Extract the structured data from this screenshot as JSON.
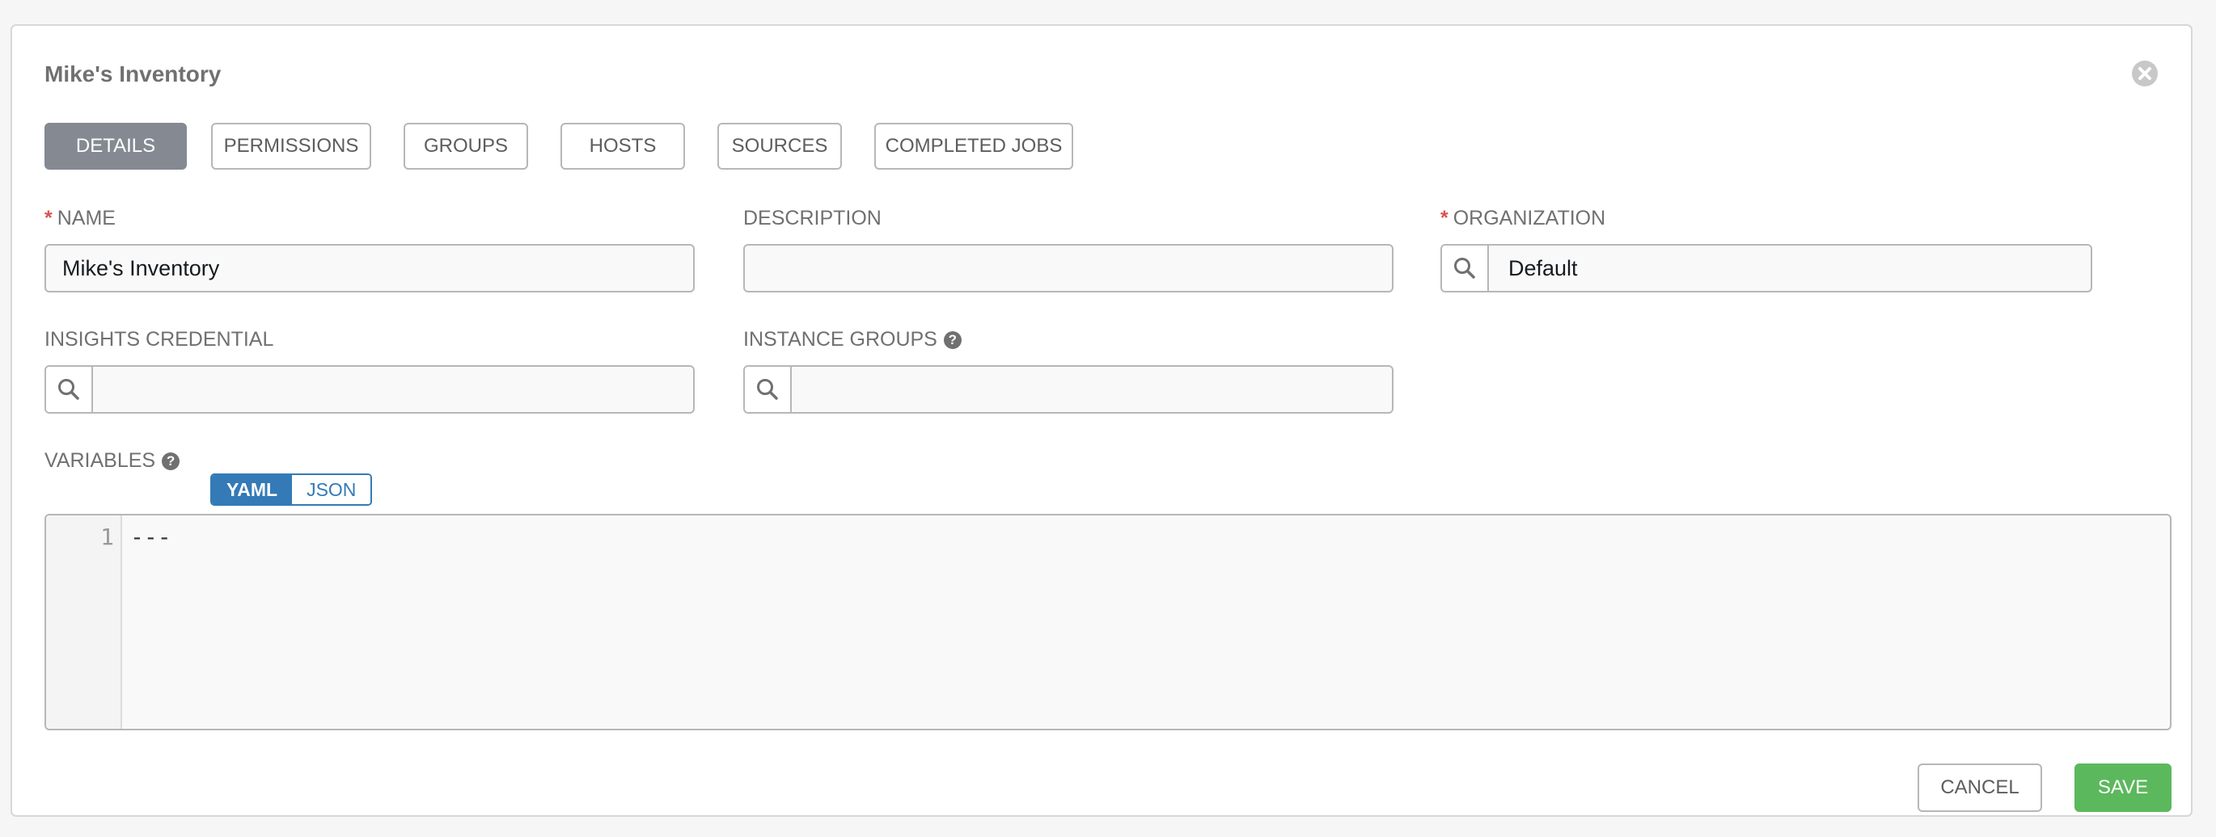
{
  "dialog": {
    "title": "Mike's Inventory",
    "close_icon": "close-circle-icon"
  },
  "tabs": [
    {
      "label": "DETAILS",
      "active": true
    },
    {
      "label": "PERMISSIONS",
      "active": false
    },
    {
      "label": "GROUPS",
      "active": false
    },
    {
      "label": "HOSTS",
      "active": false
    },
    {
      "label": "SOURCES",
      "active": false
    },
    {
      "label": "COMPLETED JOBS",
      "active": false
    }
  ],
  "form": {
    "name": {
      "label": "NAME",
      "required_marker": "*",
      "value": "Mike's Inventory"
    },
    "description": {
      "label": "DESCRIPTION",
      "value": ""
    },
    "organization": {
      "label": "ORGANIZATION",
      "required_marker": "*",
      "value": "Default",
      "icon": "search-icon"
    },
    "insights_credential": {
      "label": "INSIGHTS CREDENTIAL",
      "value": "",
      "icon": "search-icon"
    },
    "instance_groups": {
      "label": "INSTANCE GROUPS",
      "help_icon": "question-circle-icon",
      "value": "",
      "icon": "search-icon"
    },
    "variables": {
      "label": "VARIABLES",
      "help_icon": "question-circle-icon",
      "modes": [
        "YAML",
        "JSON"
      ],
      "selected_mode": "YAML",
      "lines": [
        {
          "number": "1",
          "text": "---"
        }
      ]
    }
  },
  "actions": {
    "cancel_label": "CANCEL",
    "save_label": "SAVE"
  },
  "colors": {
    "active_tab": "#848992",
    "toggle_accent": "#337ab7",
    "save_green": "#5cb85c",
    "required_red": "#d9534f"
  }
}
